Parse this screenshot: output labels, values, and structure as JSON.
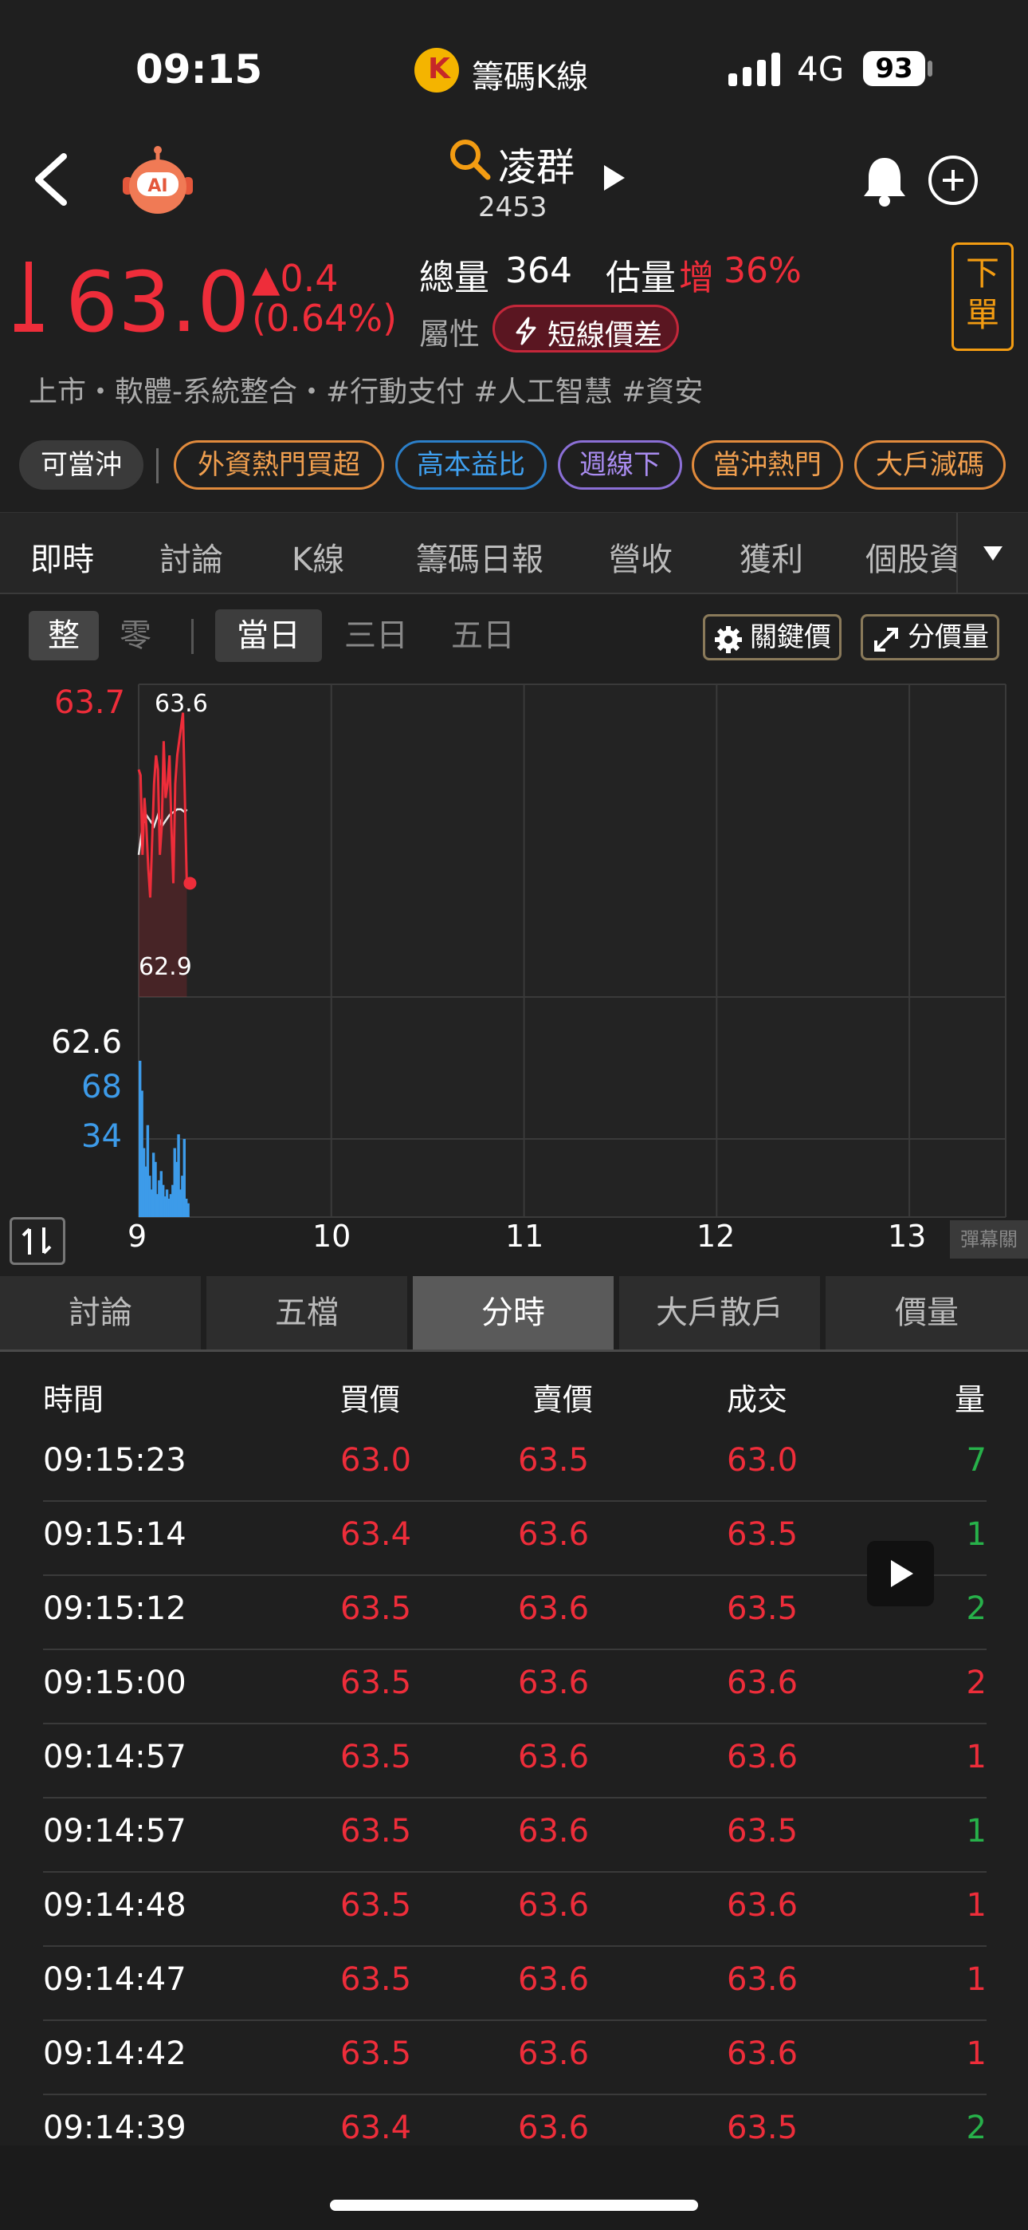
{
  "status_bar": {
    "time": "09:15",
    "app_name": "籌碼K線",
    "network": "4G",
    "battery": "93"
  },
  "header": {
    "stock_name": "凌群",
    "stock_code": "2453"
  },
  "quote": {
    "price": "63.0",
    "change": "▲0.4",
    "change_pct": "(0.64%)",
    "volume_label": "總量",
    "volume": "364",
    "est_label": "估量",
    "est_direction": "增",
    "est_value": "36%",
    "attr_label": "屬性",
    "attr_badge": "短線價差",
    "order_button": "下單",
    "tags_line": "上市・軟體-系統整合・#行動支付 #人工智慧 #資安"
  },
  "chips": [
    "可當沖",
    "外資熱門買超",
    "高本益比",
    "週線下",
    "當沖熱門",
    "大戶減碼"
  ],
  "main_tabs": [
    "即時",
    "討論",
    "K線",
    "籌碼日報",
    "營收",
    "獲利",
    "個股資"
  ],
  "chart_controls": {
    "seg_whole": "整",
    "seg_odd": "零",
    "range_day": "當日",
    "range_3d": "三日",
    "range_5d": "五日",
    "key_price": "關鍵價",
    "price_volume": "分價量"
  },
  "chart_data": {
    "type": "line",
    "y_axis_labels": {
      "high": "63.7",
      "low": "62.6",
      "vol_high": "68",
      "vol_mid": "34"
    },
    "annotations": {
      "max": "63.6",
      "min": "62.9"
    },
    "x_ticks": [
      "9",
      "10",
      "11",
      "12",
      "13"
    ],
    "xlim_hours": [
      9,
      13.5
    ],
    "ylim": [
      62.6,
      63.7
    ],
    "vol_lim": [
      0,
      68
    ],
    "price_series": {
      "name": "",
      "x": [
        9.0,
        9.01,
        9.02,
        9.03,
        9.04,
        9.05,
        9.06,
        9.07,
        9.08,
        9.09,
        9.1,
        9.11,
        9.12,
        9.13,
        9.14,
        9.15,
        9.16,
        9.17,
        9.18,
        9.19,
        9.2,
        9.21,
        9.22,
        9.23,
        9.24,
        9.25
      ],
      "y": [
        63.4,
        63.38,
        63.1,
        63.3,
        63.2,
        63.05,
        62.95,
        63.15,
        63.35,
        63.45,
        63.4,
        63.1,
        63.2,
        63.5,
        63.3,
        63.35,
        63.45,
        63.2,
        63.0,
        63.35,
        63.45,
        63.5,
        63.55,
        63.6,
        63.3,
        63.0
      ]
    },
    "avg_series": {
      "name": "",
      "x": [
        9.0,
        9.02,
        9.04,
        9.06,
        9.08,
        9.1,
        9.12,
        9.14,
        9.16,
        9.18,
        9.2,
        9.22,
        9.24,
        9.25
      ],
      "y": [
        63.1,
        63.2,
        63.24,
        63.22,
        63.2,
        63.24,
        63.2,
        63.22,
        63.24,
        63.25,
        63.26,
        63.26,
        63.25,
        63.26
      ]
    },
    "volume_series": {
      "name": "",
      "x": [
        9.0,
        9.01,
        9.02,
        9.03,
        9.04,
        9.05,
        9.06,
        9.07,
        9.08,
        9.09,
        9.1,
        9.11,
        9.12,
        9.13,
        9.14,
        9.15,
        9.16,
        9.17,
        9.18,
        9.19,
        9.2,
        9.21,
        9.22,
        9.23,
        9.24,
        9.25
      ],
      "y": [
        68,
        55,
        30,
        22,
        40,
        18,
        12,
        28,
        24,
        10,
        16,
        20,
        14,
        9,
        12,
        8,
        10,
        14,
        30,
        24,
        36,
        12,
        18,
        34,
        8,
        6
      ]
    }
  },
  "sub_tabs": [
    "討論",
    "五檔",
    "分時",
    "大戶散戶",
    "價量"
  ],
  "table": {
    "headers": {
      "time": "時間",
      "bid": "買價",
      "ask": "賣價",
      "deal": "成交",
      "vol": "量"
    },
    "rows": [
      {
        "time": "09:15:23",
        "bid": "63.0",
        "ask": "63.5",
        "deal": "63.0",
        "vol": "7",
        "side": "sell"
      },
      {
        "time": "09:15:14",
        "bid": "63.4",
        "ask": "63.6",
        "deal": "63.5",
        "vol": "1",
        "side": "sell"
      },
      {
        "time": "09:15:12",
        "bid": "63.5",
        "ask": "63.6",
        "deal": "63.5",
        "vol": "2",
        "side": "sell"
      },
      {
        "time": "09:15:00",
        "bid": "63.5",
        "ask": "63.6",
        "deal": "63.6",
        "vol": "2",
        "side": "buy"
      },
      {
        "time": "09:14:57",
        "bid": "63.5",
        "ask": "63.6",
        "deal": "63.6",
        "vol": "1",
        "side": "buy"
      },
      {
        "time": "09:14:57",
        "bid": "63.5",
        "ask": "63.6",
        "deal": "63.5",
        "vol": "1",
        "side": "sell"
      },
      {
        "time": "09:14:48",
        "bid": "63.5",
        "ask": "63.6",
        "deal": "63.6",
        "vol": "1",
        "side": "buy"
      },
      {
        "time": "09:14:47",
        "bid": "63.5",
        "ask": "63.6",
        "deal": "63.6",
        "vol": "1",
        "side": "buy"
      },
      {
        "time": "09:14:42",
        "bid": "63.5",
        "ask": "63.6",
        "deal": "63.6",
        "vol": "1",
        "side": "buy"
      },
      {
        "time": "09:14:39",
        "bid": "63.4",
        "ask": "63.6",
        "deal": "63.5",
        "vol": "2",
        "side": "sell"
      }
    ]
  },
  "danmaku_label": "彈幕關",
  "colors": {
    "up": "#ee2d3a",
    "down": "#27b14a",
    "volume": "#3d9be9",
    "accent": "#f39c12"
  }
}
